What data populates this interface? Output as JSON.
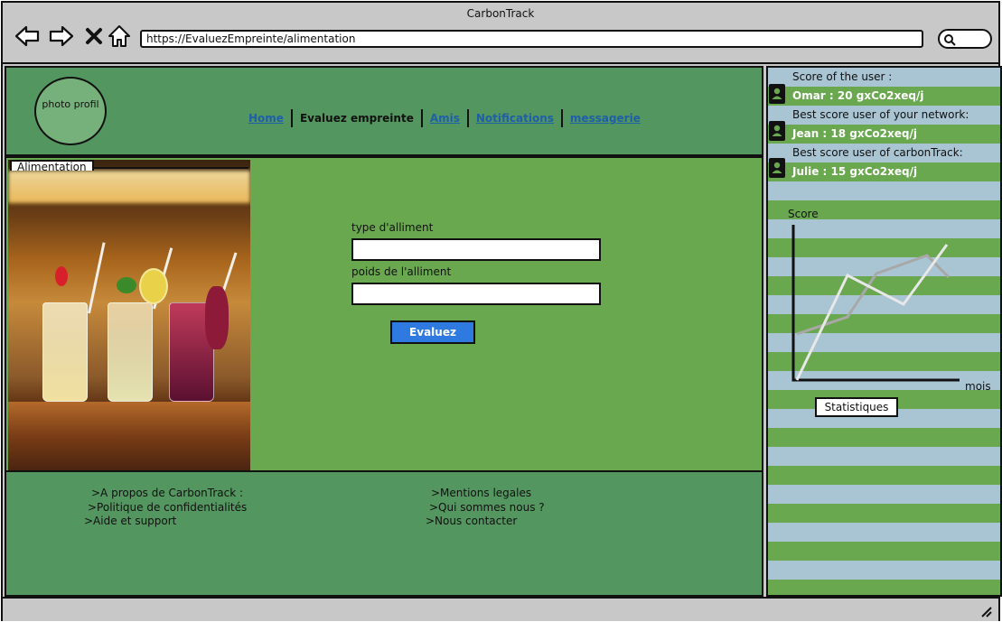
{
  "window": {
    "title": "CarbonTrack"
  },
  "browser": {
    "url": "https://EvaluezEmpreinte/alimentation"
  },
  "header": {
    "profile_label": "photo profil",
    "nav": [
      {
        "label": "Home",
        "current": false
      },
      {
        "label": "Evaluez empreinte",
        "current": true
      },
      {
        "label": "Amis",
        "current": false
      },
      {
        "label": "Notifications",
        "current": false
      },
      {
        "label": "messagerie",
        "current": false
      }
    ]
  },
  "main": {
    "section_title": "Alimentation",
    "food_type_label": "type d'alliment",
    "food_type_value": "",
    "food_weight_label": "poids de l'alliment",
    "food_weight_value": "",
    "submit_label": "Evaluez"
  },
  "footer": {
    "left_links": [
      ">A propos de CarbonTrack :",
      ">Politique de confidentialités",
      ">Aide et support"
    ],
    "right_links": [
      ">Mentions legales",
      ">Qui sommes nous ?",
      ">Nous contacter"
    ]
  },
  "sidebar": {
    "user_score_label": "Score of the user :",
    "user_score": "Omar : 20 gxCo2xeq/j",
    "network_best_label": "Best score  user of your network:",
    "network_best": "Jean : 18 gxCo2xeq/j",
    "global_best_label": "Best score  user of carbonTrack:",
    "global_best": "Julie : 15 gxCo2xeq/j",
    "chart_ylabel": "Score",
    "chart_xlabel": "mois",
    "stats_button": "Statistiques"
  },
  "colors": {
    "header_green": "#54965f",
    "main_green": "#6aa84f",
    "sidebar_blue": "#a9c4d3",
    "button_blue": "#2f7ae0"
  }
}
